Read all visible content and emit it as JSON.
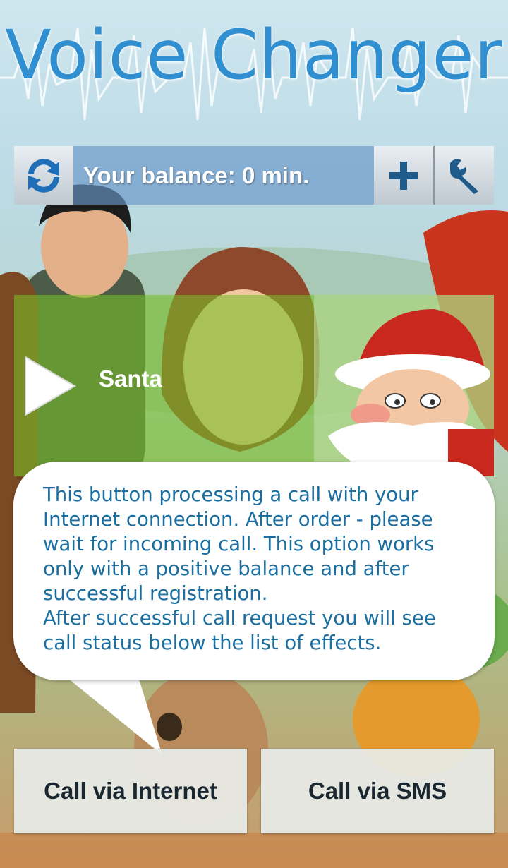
{
  "header": {
    "title": "Voice Changer"
  },
  "balance_bar": {
    "refresh_icon": "refresh-icon",
    "balance_text": "Your balance: 0 min.",
    "add_icon": "plus-icon",
    "settings_icon": "wrench-icon"
  },
  "effect": {
    "play_icon": "play-icon",
    "name": "Santa"
  },
  "tooltip": {
    "text": "This button processing a call with your\nInternet connection. After order - please\nwait for incoming call. This option works\nonly with a positive balance and after\nsuccessful registration.\nAfter successful call request you will see\ncall status below the list of effects."
  },
  "actions": {
    "call_internet": "Call via Internet",
    "call_sms": "Call via SMS"
  },
  "colors": {
    "title": "#2f8fd0",
    "balance_bar": "#6896c8",
    "effect_row": "#78be28",
    "tooltip_text": "#1b6fa0"
  }
}
